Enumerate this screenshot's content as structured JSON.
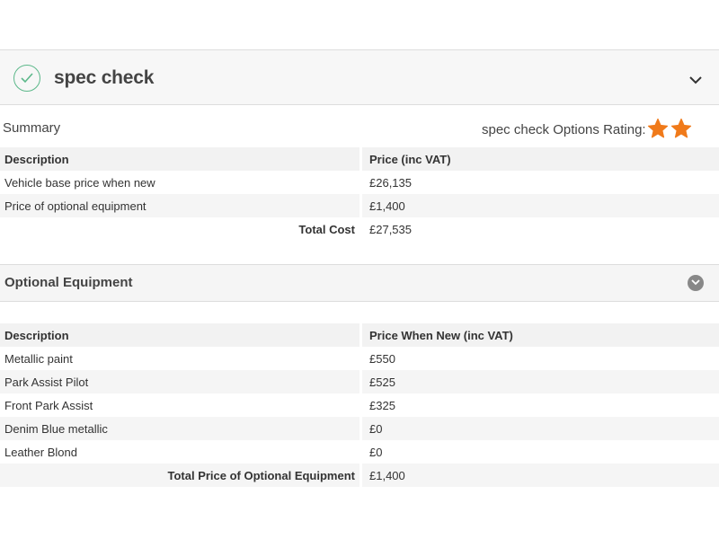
{
  "header": {
    "title": "spec check",
    "check_icon": "check-circle-icon",
    "toggle_icon": "chevron-down-icon",
    "accent_color": "#5cb88a"
  },
  "summary": {
    "label": "Summary",
    "rating_label": "spec check Options Rating:",
    "rating_value": 2,
    "rating_icon": "star-icon",
    "star_color": "#f07a1a",
    "columns": [
      "Description",
      "Price (inc VAT)"
    ],
    "rows": [
      {
        "description": "Vehicle base price when new",
        "price": "£26,135"
      },
      {
        "description": "Price of optional equipment",
        "price": "£1,400"
      }
    ],
    "total_label": "Total Cost",
    "total_value": "£27,535"
  },
  "optional": {
    "title": "Optional Equipment",
    "toggle_icon": "chevron-down-circle-icon",
    "columns": [
      "Description",
      "Price When New (inc VAT)"
    ],
    "rows": [
      {
        "description": "Metallic paint",
        "price": "£550"
      },
      {
        "description": "Park Assist Pilot",
        "price": "£525"
      },
      {
        "description": "Front Park Assist",
        "price": "£325"
      },
      {
        "description": "Denim Blue metallic",
        "price": "£0"
      },
      {
        "description": "Leather Blond",
        "price": "£0"
      }
    ],
    "total_label": "Total Price of Optional Equipment",
    "total_value": "£1,400"
  }
}
